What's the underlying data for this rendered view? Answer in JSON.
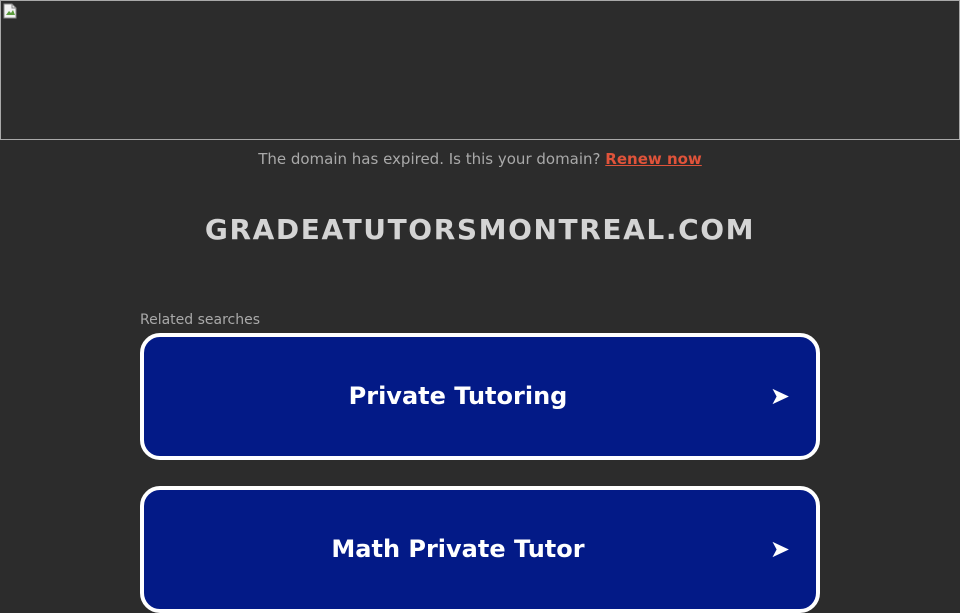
{
  "banner": {
    "image_icon": "broken-image-icon"
  },
  "notice": {
    "text": "The domain has expired. Is this your domain?",
    "link_label": "Renew now"
  },
  "domain": {
    "name": "GRADEATUTORSMONTREAL.COM"
  },
  "related": {
    "heading": "Related searches",
    "items": [
      {
        "label": "Private Tutoring",
        "icon": "arrow-right-icon"
      },
      {
        "label": "Math Private Tutor",
        "icon": "arrow-right-icon"
      }
    ]
  },
  "colors": {
    "background": "#2c2c2c",
    "card": "#031a87",
    "link": "#e0533a"
  }
}
